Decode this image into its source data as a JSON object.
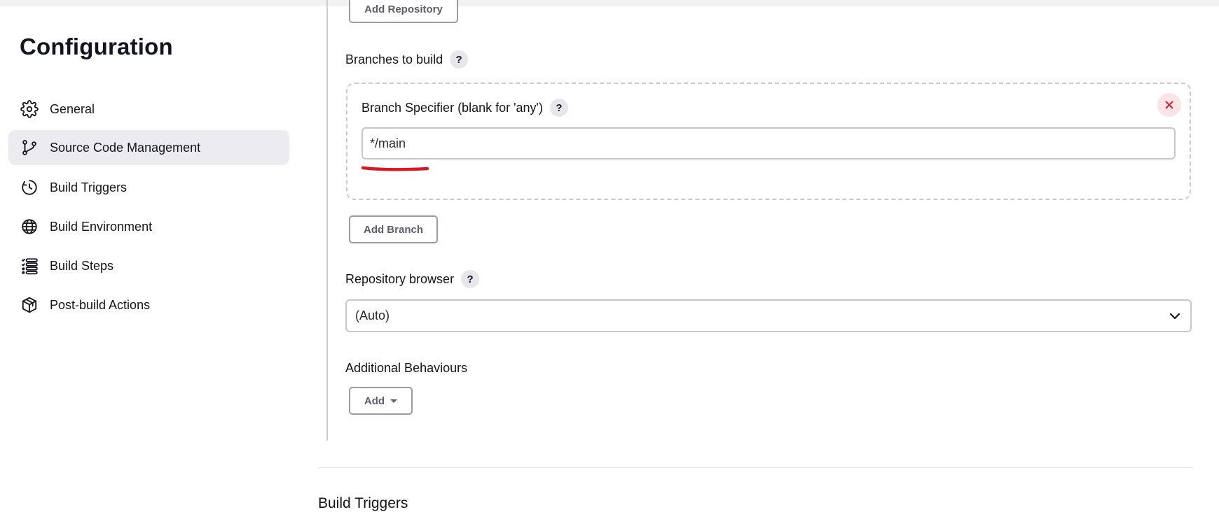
{
  "sidebar": {
    "title": "Configuration",
    "items": [
      {
        "label": "General",
        "icon": "gear-icon"
      },
      {
        "label": "Source Code Management",
        "icon": "git-branch-icon",
        "active": true
      },
      {
        "label": "Build Triggers",
        "icon": "clock-icon"
      },
      {
        "label": "Build Environment",
        "icon": "globe-icon"
      },
      {
        "label": "Build Steps",
        "icon": "list-icon"
      },
      {
        "label": "Post-build Actions",
        "icon": "package-icon"
      }
    ]
  },
  "main": {
    "add_repository_label": "Add Repository",
    "branches_to_build_label": "Branches to build",
    "branch_specifier_label": "Branch Specifier (blank for 'any')",
    "branch_specifier_value": "*/main",
    "add_branch_label": "Add Branch",
    "repository_browser_label": "Repository browser",
    "repository_browser_value": "(Auto)",
    "additional_behaviours_label": "Additional Behaviours",
    "add_label": "Add",
    "help_symbol": "?",
    "next_section_title": "Build Triggers"
  },
  "colors": {
    "accent_active_bg": "#ebebf0",
    "remove_button_bg": "#fbe4e6",
    "remove_button_fg": "#d21f3c",
    "annotation_underline": "#d51a24"
  }
}
